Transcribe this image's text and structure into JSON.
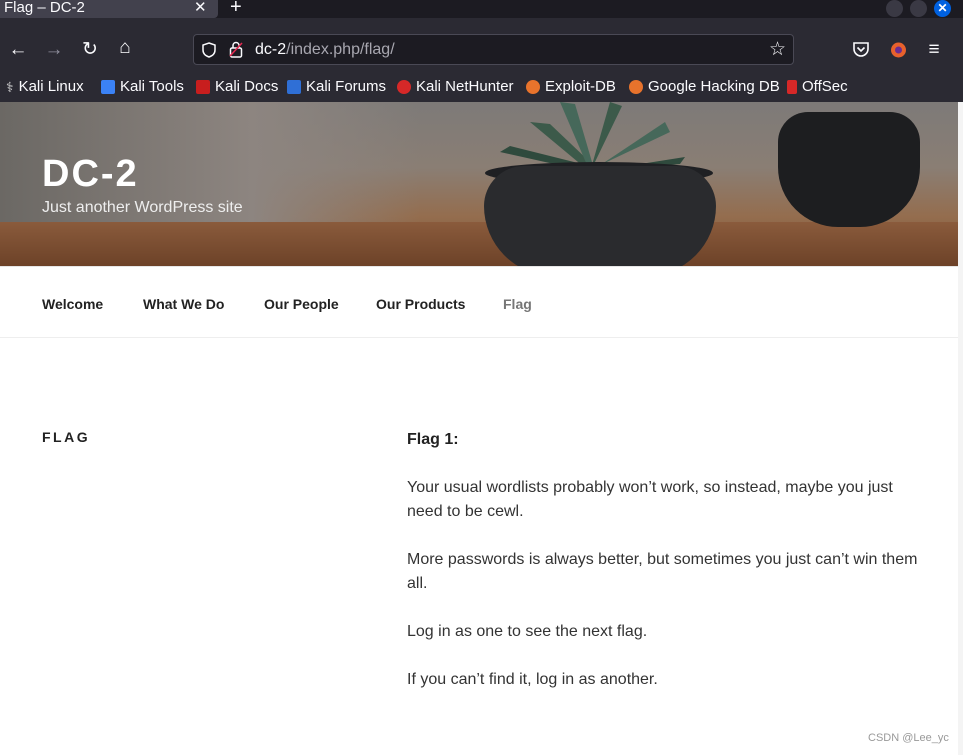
{
  "browser": {
    "tab": {
      "title": "Flag – DC-2",
      "close_glyph": "✕"
    },
    "new_tab_glyph": "+",
    "url": {
      "host": "dc-2",
      "path": "/index.php/flag/"
    },
    "bookmarks": [
      {
        "label": "Kali Linux",
        "icon": "kali-icon",
        "color": "#555555"
      },
      {
        "label": "Kali Tools",
        "icon": "kali-tools-icon",
        "color": "#3b82f6"
      },
      {
        "label": "Kali Docs",
        "icon": "kali-docs-icon",
        "color": "#c81e1e"
      },
      {
        "label": "Kali Forums",
        "icon": "kali-forums-icon",
        "color": "#2f6fd6"
      },
      {
        "label": "Kali NetHunter",
        "icon": "nethunter-icon",
        "color": "#d62828"
      },
      {
        "label": "Exploit-DB",
        "icon": "exploit-db-icon",
        "color": "#e8732c"
      },
      {
        "label": "Google Hacking DB",
        "icon": "ghdb-icon",
        "color": "#e8732c"
      },
      {
        "label": "OffSec",
        "icon": "offsec-icon",
        "color": "#d62828"
      }
    ]
  },
  "site": {
    "title": "DC-2",
    "description": "Just another WordPress site"
  },
  "menu": [
    {
      "label": "Welcome",
      "current": false
    },
    {
      "label": "What We Do",
      "current": false
    },
    {
      "label": "Our People",
      "current": false
    },
    {
      "label": "Our Products",
      "current": false
    },
    {
      "label": "Flag",
      "current": true
    }
  ],
  "page": {
    "title": "FLAG",
    "heading": "Flag 1:",
    "paragraphs": [
      "Your usual wordlists probably won’t work, so instead, maybe you just need to be cewl.",
      "More passwords is always better, but sometimes you just can’t win them all.",
      "Log in as one to see the next flag.",
      "If you can’t find it, log in as another."
    ]
  },
  "watermark": "CSDN @Lee_yc"
}
